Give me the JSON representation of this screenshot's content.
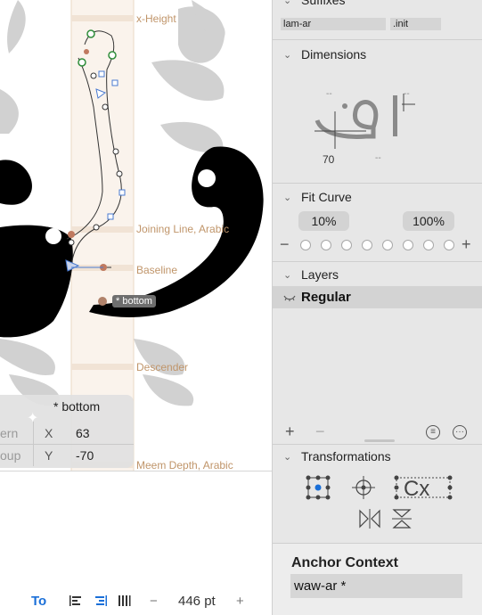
{
  "canvas": {
    "metric_lines": {
      "x_height": "x-Height",
      "joining_line": "Joining Line, Arabic",
      "baseline": "Baseline",
      "descender": "Descender",
      "meem_depth": "Meem Depth, Arabic"
    },
    "anchor_tag": "* bottom",
    "info_panel": {
      "title": "* bottom",
      "side_top": "ern",
      "side_bottom": "oup",
      "x_label": "X",
      "x_value": "63",
      "y_label": "Y",
      "y_value": "-70"
    }
  },
  "bottom_bar": {
    "text_tool": "To",
    "zoom_minus": "−",
    "font_size": "446 pt",
    "zoom_plus": "+"
  },
  "sidebar": {
    "suffixes": {
      "title": "Suffixes",
      "field1": "lam-ar",
      "field2": ".init"
    },
    "dimensions": {
      "title": "Dimensions",
      "left_top": "--",
      "right_top": "--",
      "bottom_left": "70",
      "bottom_right": "--"
    },
    "fit_curve": {
      "title": "Fit Curve",
      "left_value": "10%",
      "right_value": "100%",
      "minus": "−",
      "plus": "+",
      "dot_count": 8
    },
    "layers": {
      "title": "Layers",
      "items": [
        {
          "label": "Regular"
        }
      ],
      "add": "+",
      "remove": "−"
    },
    "transformations": {
      "title": "Transformations"
    },
    "anchor_context": {
      "title": "Anchor Context",
      "value": "waw-ar *"
    }
  },
  "colors": {
    "metric_line": "#c0956a",
    "sidebar_bg": "#e7e7e7",
    "accent": "#1a6fd8"
  }
}
